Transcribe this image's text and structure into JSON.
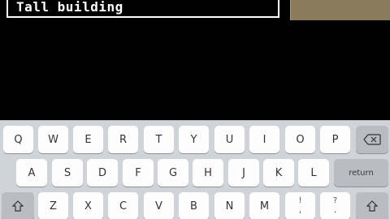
{
  "search": {
    "value": "Tall building"
  },
  "keyboard": {
    "row1": [
      "Q",
      "W",
      "E",
      "R",
      "T",
      "Y",
      "U",
      "I",
      "O",
      "P"
    ],
    "row2": [
      "A",
      "S",
      "D",
      "F",
      "G",
      "H",
      "J",
      "K",
      "L"
    ],
    "row3": [
      "Z",
      "X",
      "C",
      "V",
      "B",
      "N",
      "M"
    ],
    "punct1": {
      "alt": "!",
      "main": ","
    },
    "punct2": {
      "alt": "?",
      "main": "."
    },
    "return_label": "return",
    "icons": {
      "delete": "backspace-icon",
      "shift": "shift-icon"
    }
  },
  "colors": {
    "background": "#000000",
    "keyboard_bg": "#d0d3d8",
    "key_bg": "#fdfdfd",
    "special_key_bg": "#b9bcc3",
    "corner_button": "#8a7a5c"
  }
}
